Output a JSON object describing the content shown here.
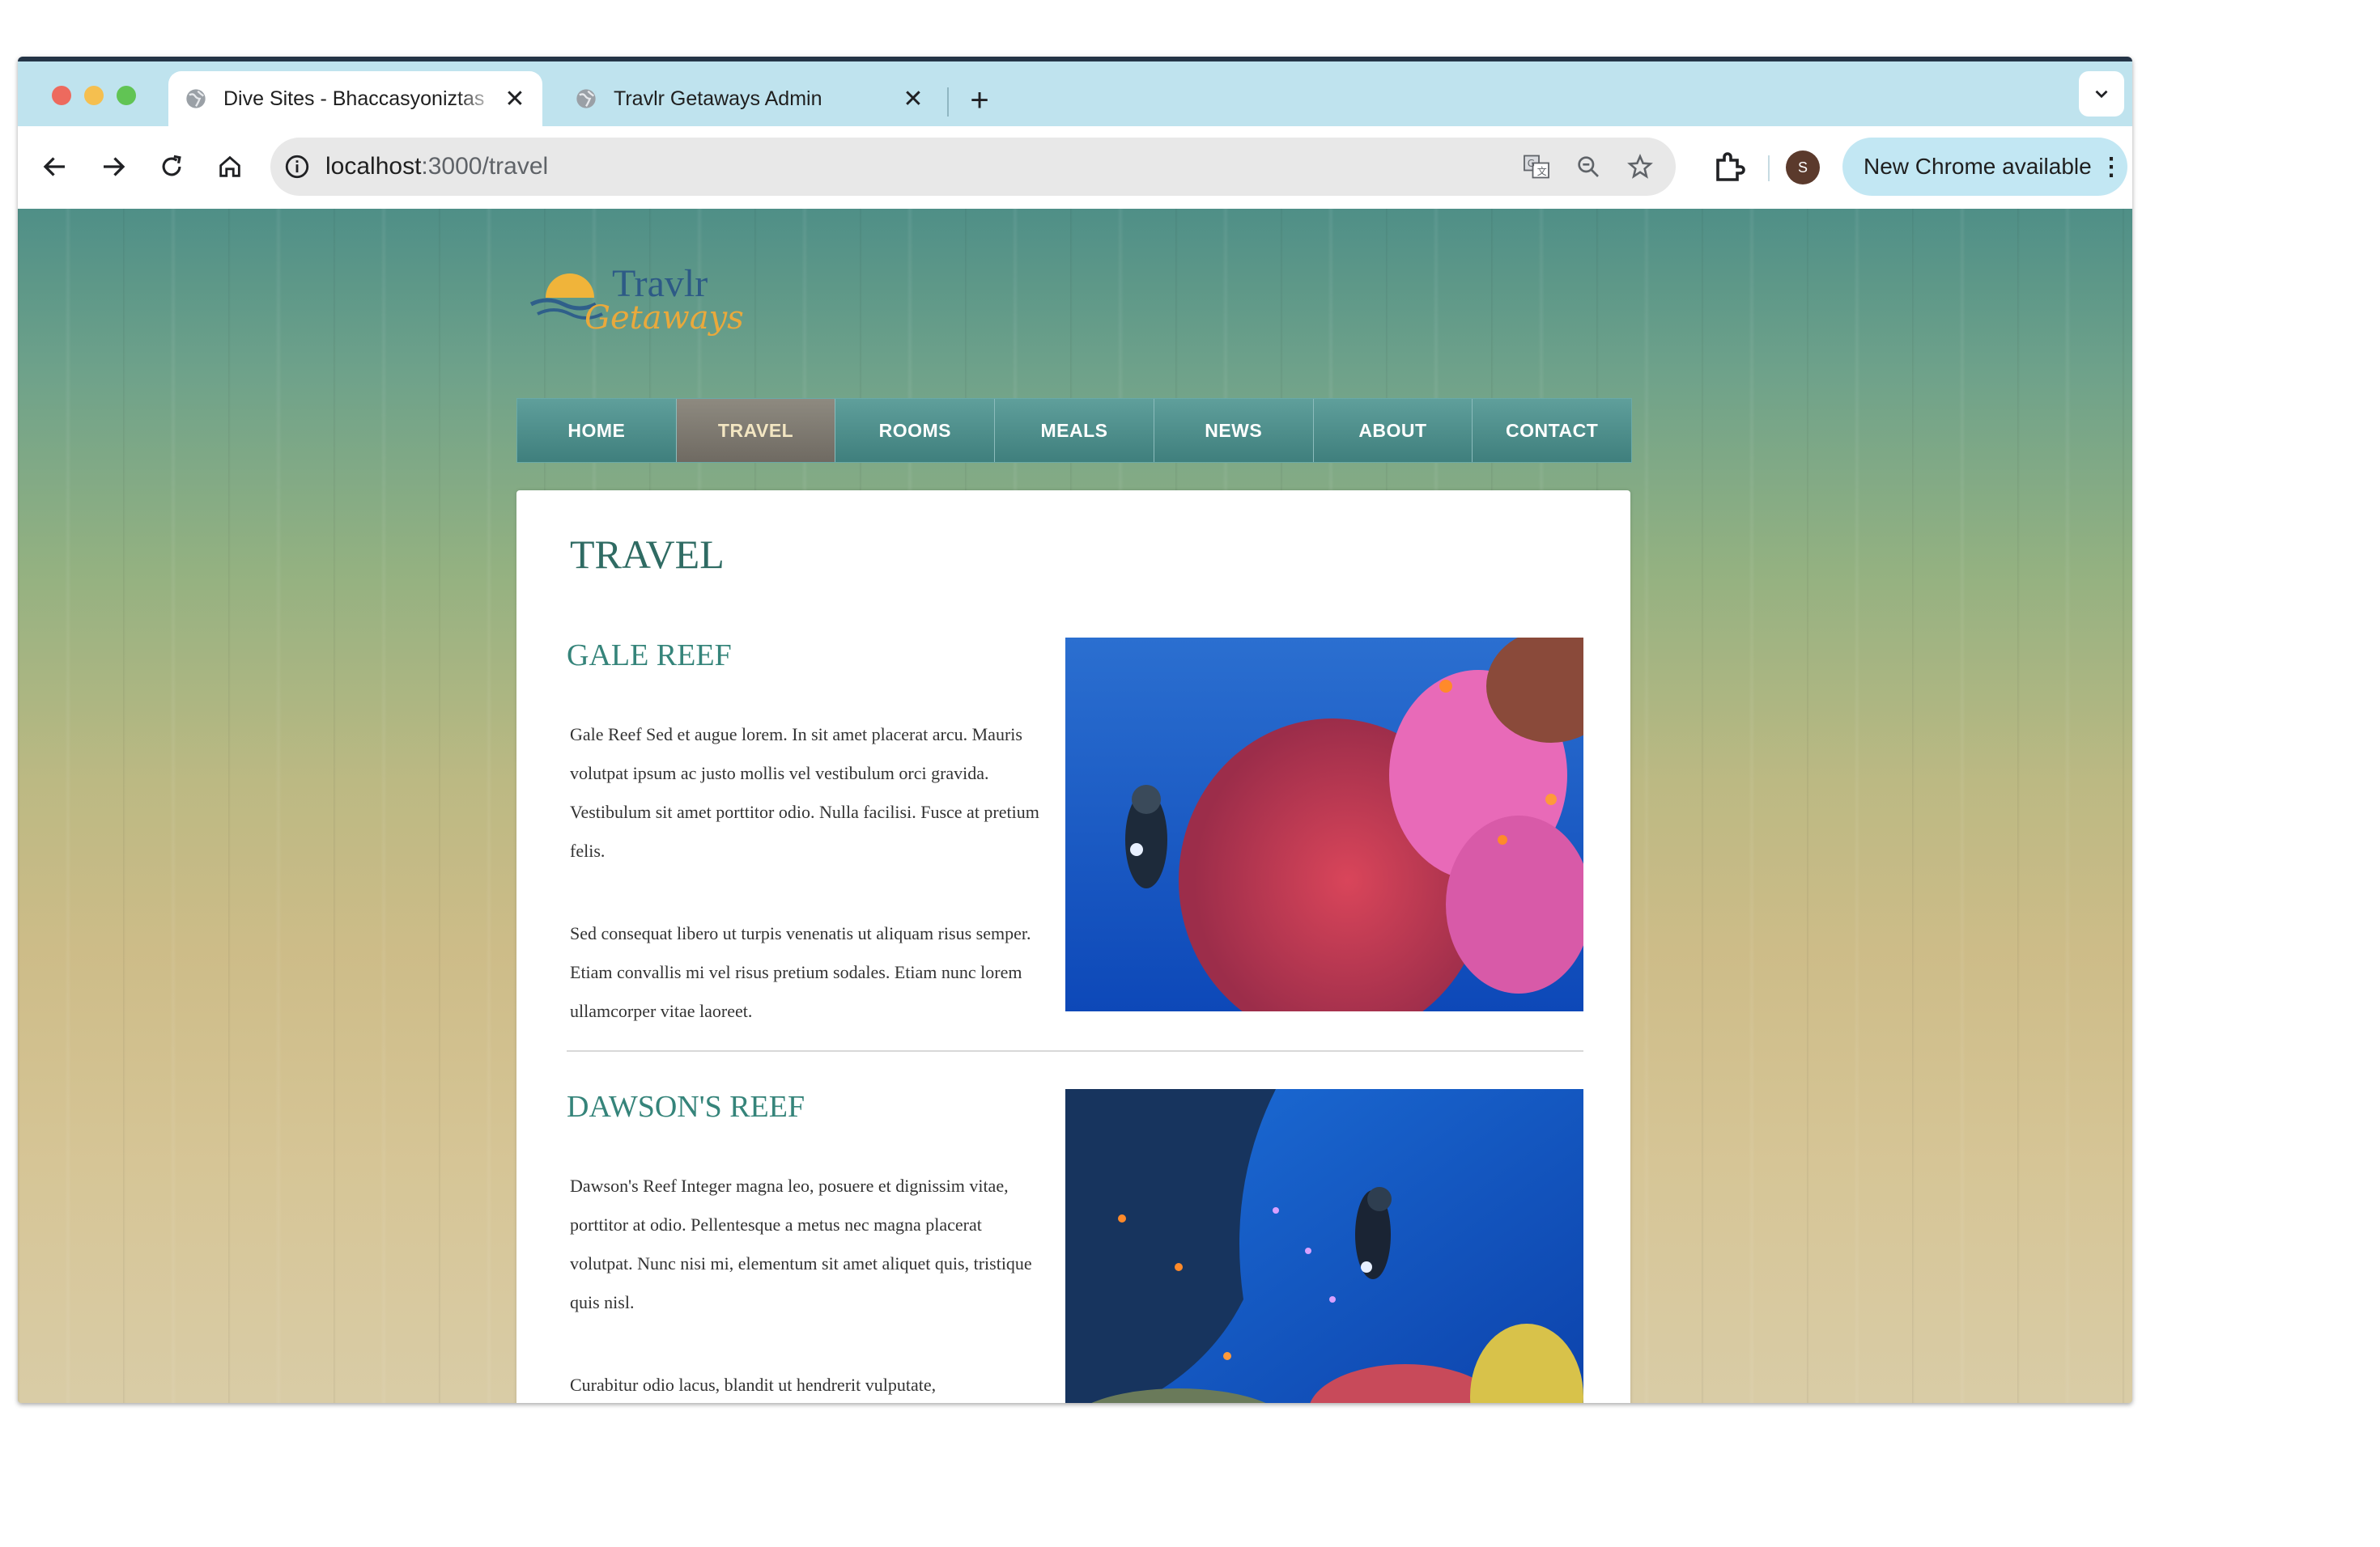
{
  "browser": {
    "tabs": [
      {
        "title": "Dive Sites - Bhaccasyoniztas",
        "active": true
      },
      {
        "title": "Travlr Getaways Admin",
        "active": false
      }
    ],
    "close_glyph": "✕",
    "new_tab_glyph": "+",
    "url_host": "localhost",
    "url_path": ":3000/travel",
    "avatar_initial": "S",
    "update_label": "New Chrome available",
    "menu_glyph": "⋮"
  },
  "site": {
    "logo_text_top": "Travlr",
    "logo_text_bottom": "Getaways",
    "nav": [
      "HOME",
      "TRAVEL",
      "ROOMS",
      "MEALS",
      "NEWS",
      "ABOUT",
      "CONTACT"
    ],
    "active_nav": "TRAVEL",
    "page_title": "TRAVEL",
    "dive_sites": [
      {
        "name": "GALE REEF",
        "paragraphs": [
          "Gale Reef Sed et augue lorem. In sit amet placerat arcu. Mauris volutpat ipsum ac justo mollis vel vestibulum orci gravida. Vestibulum sit amet porttitor odio. Nulla facilisi. Fusce at pretium felis.",
          "Sed consequat libero ut turpis venenatis ut aliquam risus semper. Etiam convallis mi vel risus pretium sodales. Etiam nunc lorem ullamcorper vitae laoreet."
        ]
      },
      {
        "name": "DAWSON'S REEF",
        "paragraphs": [
          "Dawson's Reef Integer magna leo, posuere et dignissim vitae, porttitor at odio. Pellentesque a metus nec magna placerat volutpat. Nunc nisi mi, elementum sit amet aliquet quis, tristique quis nisl.",
          "Curabitur odio lacus, blandit ut hendrerit vulputate,"
        ]
      }
    ]
  },
  "colors": {
    "tab_strip": "#bfe3ee",
    "nav_teal": "#4f8f8c",
    "nav_active": "#7f7a72",
    "heading_teal": "#35847a"
  },
  "icons": [
    "globe-icon",
    "back-arrow-icon",
    "forward-arrow-icon",
    "reload-icon",
    "home-icon",
    "site-info-icon",
    "translate-icon",
    "zoom-icon",
    "bookmark-star-icon",
    "extensions-icon",
    "tab-search-chevron-icon"
  ]
}
